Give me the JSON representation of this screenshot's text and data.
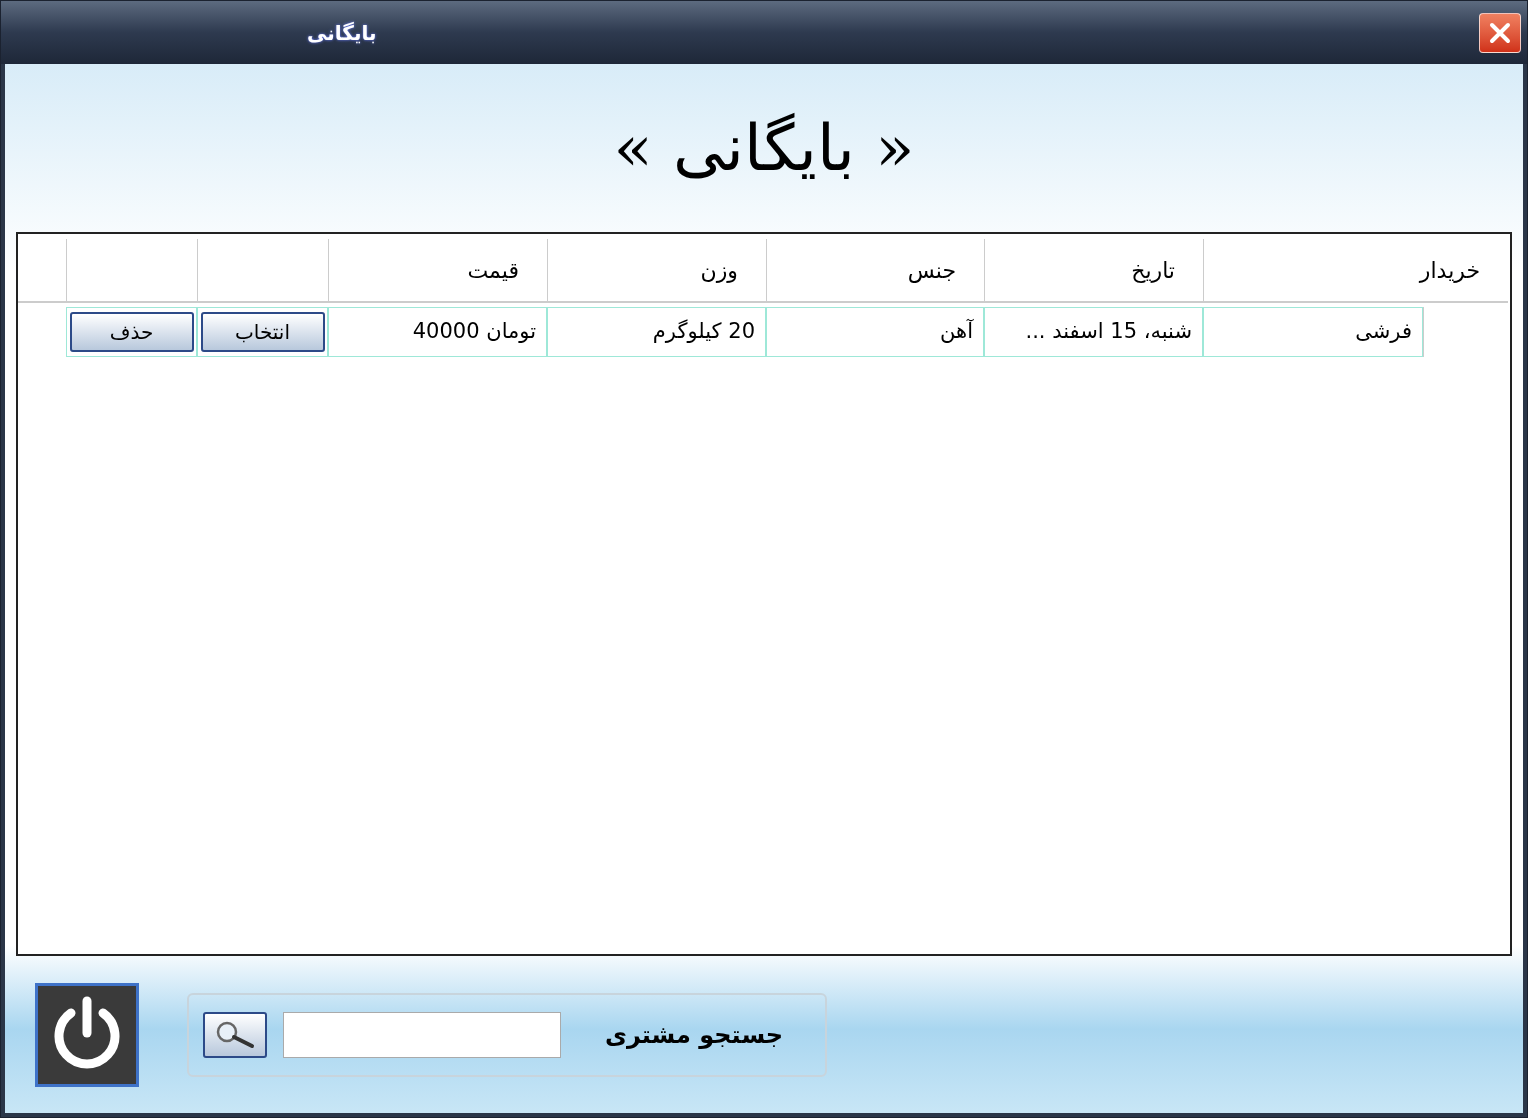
{
  "window": {
    "title": "بایگانی"
  },
  "heading": "« بایگانی »",
  "table": {
    "columns": [
      "خریدار",
      "تاریخ",
      "جنس",
      "وزن",
      "قیمت"
    ],
    "rows": [
      {
        "cells": [
          "فرشی",
          "شنبه، 15 اسفند ...",
          "آهن",
          "20 کیلوگرم",
          "40000  تومان"
        ],
        "buttons": [
          "انتخاب",
          "حذف"
        ]
      }
    ]
  },
  "search": {
    "label": "جستجو مشتری"
  }
}
